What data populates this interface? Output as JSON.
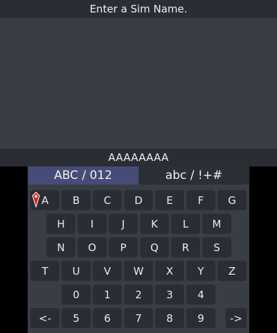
{
  "top": {
    "prompt": "Enter a Sim Name.",
    "name_value": "AAAAAAAA"
  },
  "tabs": {
    "active": "ABC / 012",
    "inactive": "abc / !+#"
  },
  "keys": {
    "row1": [
      "A",
      "B",
      "C",
      "D",
      "E",
      "F",
      "G"
    ],
    "row2": [
      "H",
      "I",
      "J",
      "K",
      "L",
      "M"
    ],
    "row3": [
      "N",
      "O",
      "P",
      "Q",
      "R",
      "S"
    ],
    "row4": [
      "T",
      "U",
      "V",
      "W",
      "X",
      "Y",
      "Z"
    ],
    "row5": [
      "0",
      "1",
      "2",
      "3",
      "4"
    ],
    "row6": [
      "<-",
      "5",
      "6",
      "7",
      "8",
      "9",
      "->"
    ]
  },
  "icons": {
    "cursor": "red-pen-cursor-icon"
  },
  "colors": {
    "active_tab": "#474b77",
    "bar": "#2a2d33",
    "panel": "#393d44",
    "cursor": "#d8252a"
  }
}
